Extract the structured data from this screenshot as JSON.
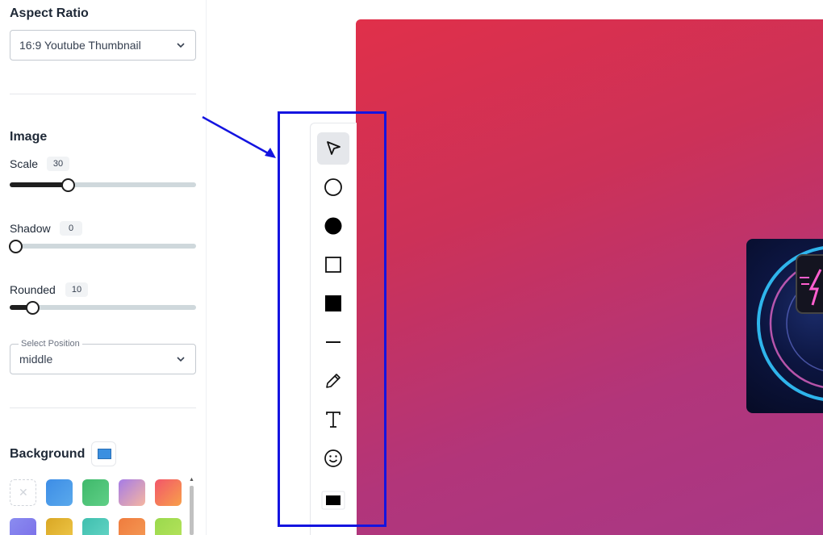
{
  "aspect_ratio": {
    "title": "Aspect Ratio",
    "selected": "16:9 Youtube Thumbnail"
  },
  "image": {
    "title": "Image",
    "sliders": [
      {
        "label": "Scale",
        "value": "30",
        "fraction": 0.31
      },
      {
        "label": "Shadow",
        "value": "0",
        "fraction": 0.0
      },
      {
        "label": "Rounded",
        "value": "10",
        "fraction": 0.12
      }
    ],
    "position": {
      "label": "Select Position",
      "selected": "middle"
    }
  },
  "background": {
    "title": "Background",
    "current_color": "#3b8fe0",
    "swatches": [
      {
        "name": "none"
      },
      {
        "name": "blue",
        "from": "#3d8de6",
        "to": "#5aa9ec"
      },
      {
        "name": "green",
        "from": "#3fb96b",
        "to": "#5fcf86"
      },
      {
        "name": "purple-peach",
        "from": "#a57be6",
        "to": "#f6b6a0"
      },
      {
        "name": "orange-red",
        "from": "#f2566a",
        "to": "#f8a04a"
      },
      {
        "name": "blue-violet",
        "from": "#8a8cf0",
        "to": "#7a6de8"
      },
      {
        "name": "yellow",
        "from": "#d9a724",
        "to": "#f0c84a"
      },
      {
        "name": "teal",
        "from": "#3fbfae",
        "to": "#67d6c7"
      },
      {
        "name": "orange",
        "from": "#ef7c3e",
        "to": "#f59b56"
      },
      {
        "name": "lime",
        "from": "#9ad94d",
        "to": "#b7e35c"
      }
    ]
  },
  "toolbar": {
    "tools": [
      {
        "name": "select-tool",
        "icon": "cursor-icon",
        "active": true
      },
      {
        "name": "circle-outline-tool",
        "icon": "circle-outline-icon"
      },
      {
        "name": "circle-filled-tool",
        "icon": "circle-filled-icon"
      },
      {
        "name": "square-outline-tool",
        "icon": "square-outline-icon"
      },
      {
        "name": "square-filled-tool",
        "icon": "square-filled-icon"
      },
      {
        "name": "line-tool",
        "icon": "line-icon"
      },
      {
        "name": "pencil-tool",
        "icon": "pencil-icon"
      },
      {
        "name": "text-tool",
        "icon": "text-icon"
      },
      {
        "name": "emoji-tool",
        "icon": "smiley-icon"
      },
      {
        "name": "color-tool",
        "icon": "color-swatch-icon",
        "color": "#000000"
      }
    ]
  },
  "annotation": {
    "color": "#1414e0"
  }
}
